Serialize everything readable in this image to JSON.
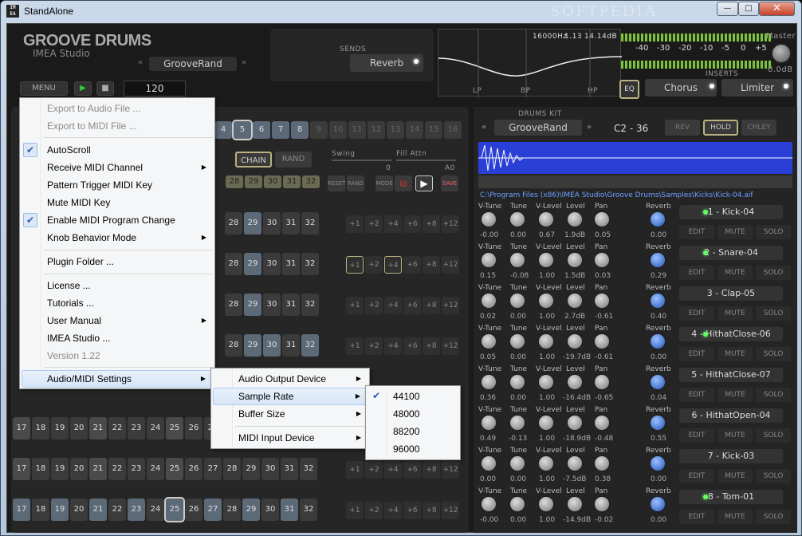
{
  "window": {
    "title": "StandAlone",
    "watermark": "SOFTPEDIA",
    "icon_text": "IM EA",
    "min": "—",
    "max": "□",
    "close": "✕"
  },
  "header": {
    "brand": "GROOVE DRUMS",
    "brand_sub": "IMEA Studio",
    "preset": "GrooveRand",
    "prev": "«",
    "next": "»",
    "menu_label": "MENU",
    "bpm": "120"
  },
  "sends": {
    "label": "SENDS",
    "reverb": "Reverb"
  },
  "eq": {
    "freq": "16000Hz",
    "q": "1.13",
    "gain": "14.14dB",
    "lp": "LP",
    "bp": "BP",
    "hp": "HP",
    "button": "EQ"
  },
  "meter": {
    "ticks": [
      "-40",
      "-30",
      "-20",
      "-10",
      "-5",
      "0",
      "+5"
    ],
    "master_label": "Master",
    "master_value": "0.0dB"
  },
  "inserts": {
    "label": "INSERTS",
    "chorus": "Chorus",
    "limiter": "Limiter"
  },
  "kit": {
    "label": "DRUMS KIT",
    "name": "GrooveRand",
    "range": "C2 - 36",
    "rev": "REV",
    "hold": "HOLD",
    "chley": "CHLEY",
    "path": "C:\\Program Files (x86)\\IMEA Studio\\Groove Drums\\Samples\\Kicks\\Kick-04.aif"
  },
  "knob_labels": [
    "V-Tune",
    "Tune",
    "V-Level",
    "Level",
    "Pan"
  ],
  "reverb_label": "Reverb",
  "channel_buttons": {
    "edit": "EDIT",
    "mute": "MUTE",
    "solo": "SOLO"
  },
  "channels": [
    {
      "name": "1 - Kick-04",
      "vals": [
        "-0.00",
        "0.00",
        "0.67",
        "1.9dB",
        "0.05"
      ],
      "rev": "0.00"
    },
    {
      "name": "2 - Snare-04",
      "vals": [
        "0.15",
        "-0.08",
        "1.00",
        "1.5dB",
        "0.03"
      ],
      "rev": "0.29"
    },
    {
      "name": "3 - Clap-05",
      "vals": [
        "0.02",
        "0.00",
        "1.00",
        "2.7dB",
        "-0.61"
      ],
      "rev": "0.40"
    },
    {
      "name": "4 - HithatClose-06",
      "vals": [
        "0.05",
        "0.00",
        "1.00",
        "-19.7dB",
        "-0.61"
      ],
      "rev": "0.00"
    },
    {
      "name": "5 - HithatClose-07",
      "vals": [
        "0.36",
        "0.00",
        "1.00",
        "-16.4dB",
        "-0.65"
      ],
      "rev": "0.04"
    },
    {
      "name": "6 - HithatOpen-04",
      "vals": [
        "0.49",
        "-0.13",
        "1.00",
        "-18.9dB",
        "-0.48"
      ],
      "rev": "0.55"
    },
    {
      "name": "7 - Kick-03",
      "vals": [
        "0.00",
        "0.00",
        "1.00",
        "-7.5dB",
        "0.38"
      ],
      "rev": "0.00"
    },
    {
      "name": "8 - Tom-01",
      "vals": [
        "-0.00",
        "0.00",
        "1.00",
        "-14.9dB",
        "-0.02"
      ],
      "rev": "0.00"
    }
  ],
  "seq": {
    "top_steps": [
      "4",
      "5",
      "6",
      "7",
      "8",
      "9",
      "10",
      "11",
      "12",
      "13",
      "14",
      "15",
      "16"
    ],
    "chain": "CHAIN",
    "rand": "RAND",
    "swing": "Swing",
    "fill": "Fill Attn",
    "swing_val": "0",
    "fill_val": "A0",
    "reset": "RESET",
    "rand2": "RAND",
    "mode": "MODE",
    "save": "SAVE",
    "acc_steps": [
      "28",
      "29",
      "30",
      "31",
      "32"
    ],
    "row_steps": [
      "28",
      "29",
      "30",
      "31",
      "32"
    ],
    "full_steps": [
      "17",
      "18",
      "19",
      "20",
      "21",
      "22",
      "23",
      "24",
      "25",
      "26",
      "27",
      "28",
      "29",
      "30",
      "31",
      "32"
    ],
    "plus": [
      "+1",
      "+2",
      "+4",
      "+6",
      "+8",
      "+12"
    ]
  },
  "menu": {
    "items": [
      {
        "label": "Export to Audio File ...",
        "disabled": true
      },
      {
        "label": "Export to MIDI File ...",
        "disabled": true
      },
      {
        "label": "AutoScroll",
        "checked": true
      },
      {
        "label": "Receive MIDI Channel",
        "sub": true
      },
      {
        "label": "Pattern Trigger MIDI Key"
      },
      {
        "label": "Mute MIDI Key"
      },
      {
        "label": "Enable MIDI Program Change",
        "checked": true
      },
      {
        "label": "Knob Behavior Mode",
        "sub": true
      },
      {
        "label": "Plugin Folder ..."
      },
      {
        "label": "License ..."
      },
      {
        "label": "Tutorials ..."
      },
      {
        "label": "User Manual",
        "sub": true
      },
      {
        "label": "IMEA Studio ..."
      },
      {
        "label": "Version 1.22",
        "disabled": true
      },
      {
        "label": "Audio/MIDI Settings",
        "sub": true
      }
    ],
    "sub1": [
      "Audio Output Device",
      "Sample Rate",
      "Buffer Size",
      "MIDI Input Device"
    ],
    "sub2": [
      "44100",
      "48000",
      "88200",
      "96000"
    ],
    "arrow": "▶",
    "check": "✔"
  }
}
